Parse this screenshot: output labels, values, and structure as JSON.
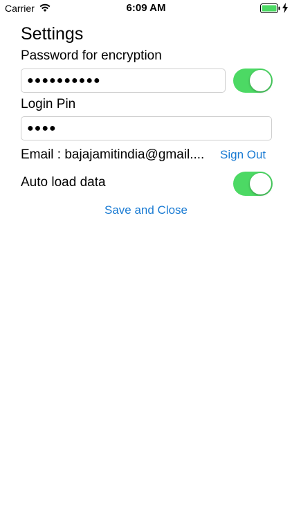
{
  "status_bar": {
    "carrier": "Carrier",
    "time": "6:09 AM",
    "icons": [
      "wifi-icon",
      "battery-icon",
      "charging-bolt-icon"
    ],
    "battery_color": "#4cd964"
  },
  "settings": {
    "title": "Settings",
    "password_label": "Password for encryption",
    "password_value": "●●●●●●●●●●",
    "encryption_toggle_on": true,
    "pin_label": "Login Pin",
    "pin_value": "●●●●",
    "email_text": "Email : bajajamitindia@gmail....",
    "sign_out_label": "Sign Out",
    "auto_load_label": "Auto load data",
    "auto_load_toggle_on": true,
    "save_close_label": "Save and Close"
  },
  "colors": {
    "toggle_on": "#4cd964",
    "link": "#1a7bd3"
  }
}
